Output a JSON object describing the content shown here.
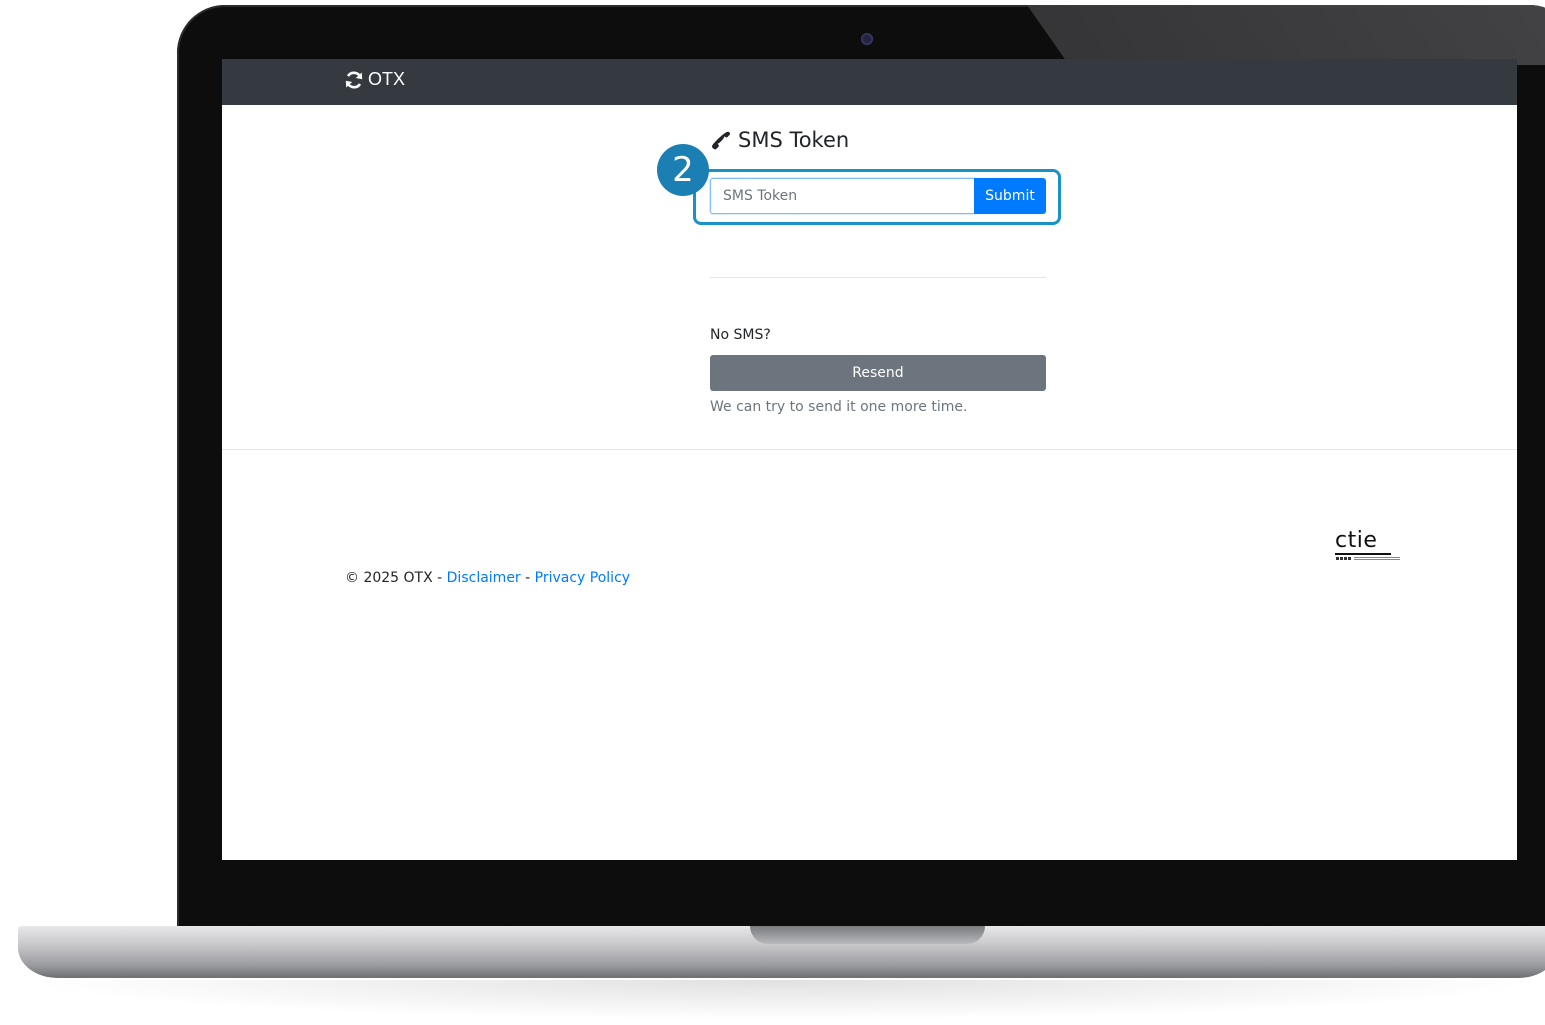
{
  "navbar": {
    "brand": "OTX"
  },
  "form": {
    "title": "SMS Token",
    "input_placeholder": "SMS Token",
    "input_value": "",
    "submit_label": "Submit"
  },
  "resend": {
    "prompt": "No SMS?",
    "button_label": "Resend",
    "help_text": "We can try to send it one more time."
  },
  "footer": {
    "copyright": "© 2025 OTX - ",
    "separator": " - ",
    "disclaimer_link": "Disclaimer",
    "privacy_link": "Privacy Policy",
    "logo_text": "ctie"
  },
  "annotation": {
    "step_number": "2",
    "color": "#1b92c6"
  },
  "icons": {
    "brand": "refresh-icon",
    "title": "phone-icon"
  },
  "colors": {
    "navbar": "#343a40",
    "primary": "#007bff",
    "secondary": "#6c757d"
  }
}
